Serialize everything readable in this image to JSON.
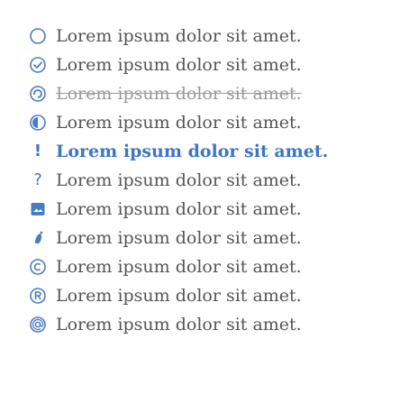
{
  "colors": {
    "accent": "#4a7cc3",
    "text": "#555555",
    "strike_text": "#9a9a9a",
    "emphasis": "#3e76c2"
  },
  "items": [
    {
      "icon": "circle-outline-icon",
      "label": "Lorem ipsum dolor sit amet.",
      "style": "normal"
    },
    {
      "icon": "check-circle-icon",
      "label": "Lorem ipsum dolor sit amet.",
      "style": "normal"
    },
    {
      "icon": "refresh-circle-icon",
      "label": "Lorem ipsum dolor sit amet.",
      "style": "strikethrough"
    },
    {
      "icon": "half-circle-icon",
      "label": "Lorem ipsum dolor sit amet.",
      "style": "normal"
    },
    {
      "icon": "exclamation-icon",
      "label": "Lorem ipsum dolor sit amet.",
      "style": "emphasis"
    },
    {
      "icon": "question-icon",
      "label": "Lorem ipsum dolor sit amet.",
      "style": "normal"
    },
    {
      "icon": "image-box-icon",
      "label": "Lorem ipsum dolor sit amet.",
      "style": "normal"
    },
    {
      "icon": "bell-tilt-icon",
      "label": "Lorem ipsum dolor sit amet.",
      "style": "normal"
    },
    {
      "icon": "copyright-circle-icon",
      "label": "Lorem ipsum dolor sit amet.",
      "style": "normal"
    },
    {
      "icon": "registered-circle-icon",
      "label": "Lorem ipsum dolor sit amet.",
      "style": "normal"
    },
    {
      "icon": "at-circle-icon",
      "label": "Lorem ipsum dolor sit amet.",
      "style": "normal"
    }
  ],
  "trailing_icons": [
    "arrow-circle-icon",
    "cycle-circle-icon",
    "refresh-circle-icon"
  ]
}
